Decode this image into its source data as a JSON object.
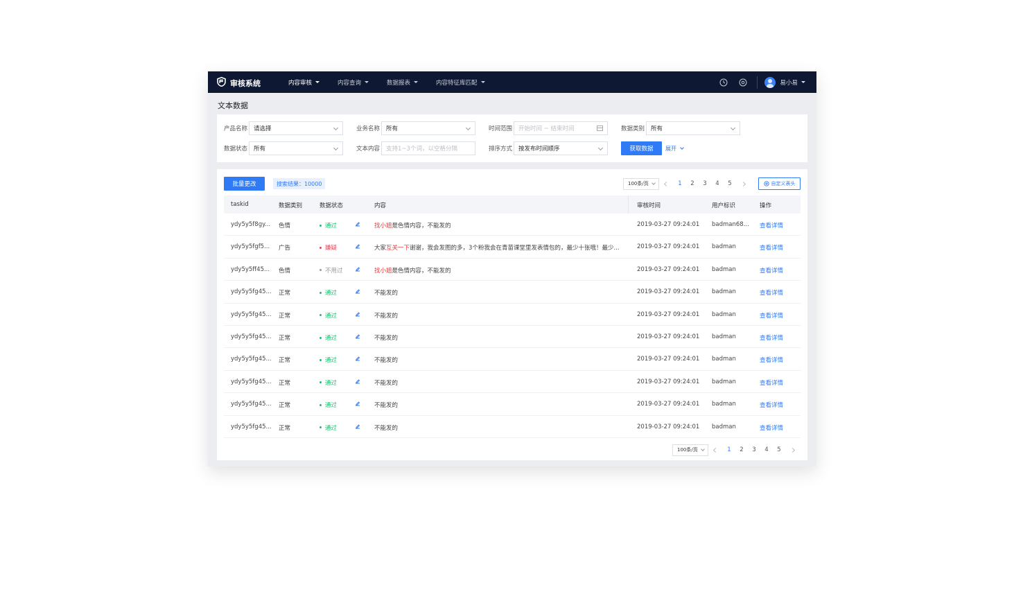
{
  "app": {
    "title": "审核系统"
  },
  "nav": [
    {
      "label": "内容审核",
      "active": true
    },
    {
      "label": "内容查询",
      "active": false
    },
    {
      "label": "数据报表",
      "active": false
    },
    {
      "label": "内容特征库匹配",
      "active": false
    }
  ],
  "user": {
    "name": "易小易"
  },
  "page": {
    "title": "文本数据"
  },
  "filters": {
    "product": {
      "label": "产品名称",
      "value": "请选择"
    },
    "business": {
      "label": "业务名称",
      "value": "所有"
    },
    "time": {
      "label": "时间范围",
      "placeholder": "开始时间 ~ 结束时间"
    },
    "category": {
      "label": "数据类别",
      "value": "所有"
    },
    "status": {
      "label": "数据状态",
      "value": "所有"
    },
    "text": {
      "label": "文本内容",
      "placeholder": "支持1~3个词，以空格分隔"
    },
    "sort": {
      "label": "排序方式",
      "value": "按发布时间顺序"
    },
    "fetch_button": "获取数据",
    "expand_link": "展开"
  },
  "toolbar": {
    "batch_button": "批量更改",
    "result_text": "搜索结果：10000",
    "custom_button": "自定义表头"
  },
  "pagination": {
    "page_size": "100条/页",
    "pages": [
      "1",
      "2",
      "3",
      "4",
      "5"
    ],
    "current": "1"
  },
  "table": {
    "headers": [
      "taskid",
      "数据类别",
      "数据状态",
      "内容",
      "审核时间",
      "用户标识",
      "操作"
    ],
    "rows": [
      {
        "taskid": "ydy5y5f8gy...",
        "category": "色情",
        "status": "通过",
        "status_color": "#19be6b",
        "content_hl": "找小姐",
        "content_pre": "",
        "content_rest": "是色情内容，不能发的",
        "time": "2019-03-27 09:24:01",
        "user": "badman68...",
        "action": "查看详情"
      },
      {
        "taskid": "ydy5y5fgf5...",
        "category": "广告",
        "status": "嫌疑",
        "status_color": "#ed4055",
        "content_pre": "大家",
        "content_hl": "互关一下",
        "content_rest": "谢谢，我会发图的多，3个粉我会在青苗课堂里发表情包的，最少十张哦！最少...",
        "time": "2019-03-27 09:24:01",
        "user": "badman",
        "action": "查看详情"
      },
      {
        "taskid": "ydy5y5ff45...",
        "category": "色情",
        "status": "不用过",
        "status_color": "#999999",
        "content_hl": "找小姐",
        "content_pre": "",
        "content_rest": "是色情内容，不能发的",
        "time": "2019-03-27 09:24:01",
        "user": "badman",
        "action": "查看详情"
      },
      {
        "taskid": "ydy5y5fg45...",
        "category": "正常",
        "status": "通过",
        "status_color": "#19be6b",
        "content_pre": "",
        "content_hl": "",
        "content_rest": "不能发的",
        "time": "2019-03-27 09:24:01",
        "user": "badman",
        "action": "查看详情"
      },
      {
        "taskid": "ydy5y5fg45...",
        "category": "正常",
        "status": "通过",
        "status_color": "#19be6b",
        "content_pre": "",
        "content_hl": "",
        "content_rest": "不能发的",
        "time": "2019-03-27 09:24:01",
        "user": "badman",
        "action": "查看详情"
      },
      {
        "taskid": "ydy5y5fg45...",
        "category": "正常",
        "status": "通过",
        "status_color": "#19be6b",
        "content_pre": "",
        "content_hl": "",
        "content_rest": "不能发的",
        "time": "2019-03-27 09:24:01",
        "user": "badman",
        "action": "查看详情"
      },
      {
        "taskid": "ydy5y5fg45...",
        "category": "正常",
        "status": "通过",
        "status_color": "#19be6b",
        "content_pre": "",
        "content_hl": "",
        "content_rest": "不能发的",
        "time": "2019-03-27 09:24:01",
        "user": "badman",
        "action": "查看详情"
      },
      {
        "taskid": "ydy5y5fg45...",
        "category": "正常",
        "status": "通过",
        "status_color": "#19be6b",
        "content_pre": "",
        "content_hl": "",
        "content_rest": "不能发的",
        "time": "2019-03-27 09:24:01",
        "user": "badman",
        "action": "查看详情"
      },
      {
        "taskid": "ydy5y5fg45...",
        "category": "正常",
        "status": "通过",
        "status_color": "#19be6b",
        "content_pre": "",
        "content_hl": "",
        "content_rest": "不能发的",
        "time": "2019-03-27 09:24:01",
        "user": "badman",
        "action": "查看详情"
      },
      {
        "taskid": "ydy5y5fg45...",
        "category": "正常",
        "status": "通过",
        "status_color": "#19be6b",
        "content_pre": "",
        "content_hl": "",
        "content_rest": "不能发的",
        "time": "2019-03-27 09:24:01",
        "user": "badman",
        "action": "查看详情"
      }
    ]
  },
  "colors": {
    "primary": "#2f7af5",
    "topbar": "#0e1833",
    "pass": "#19be6b",
    "suspect": "#ed4055",
    "highlight": "#e5383b"
  },
  "icons": {
    "logo": "shield-logo-icon",
    "history": "clock-icon",
    "settings": "gear-icon"
  }
}
